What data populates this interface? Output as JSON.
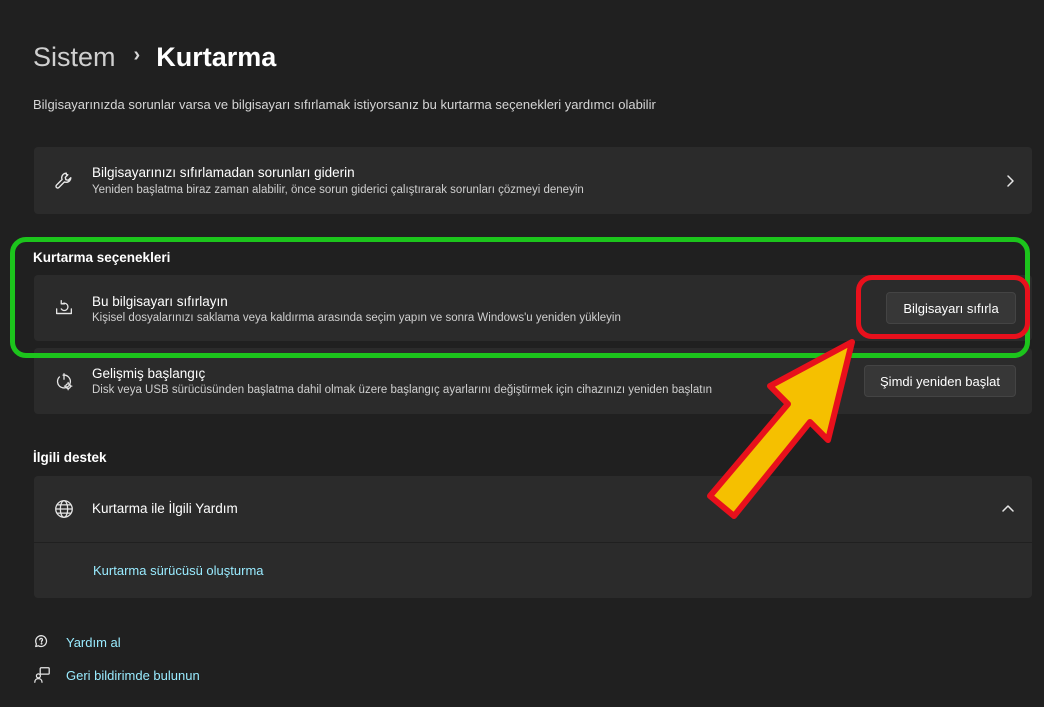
{
  "breadcrumb": {
    "parent": "Sistem",
    "separator": "›",
    "current": "Kurtarma"
  },
  "description": "Bilgisayarınızda sorunlar varsa ve bilgisayarı sıfırlamak istiyorsanız bu kurtarma seçenekleri yardımcı olabilir",
  "troubleshoot_card": {
    "icon": "wrench-icon",
    "title": "Bilgisayarınızı sıfırlamadan sorunları giderin",
    "subtitle": "Yeniden başlatma biraz zaman alabilir, önce sorun giderici çalıştırarak sorunları çözmeyi deneyin"
  },
  "recovery_options": {
    "label": "Kurtarma seçenekleri",
    "reset": {
      "icon": "reset-pc-icon",
      "title": "Bu bilgisayarı sıfırlayın",
      "subtitle": "Kişisel dosyalarınızı saklama veya kaldırma arasında seçim yapın ve sonra Windows'u yeniden yükleyin",
      "button": "Bilgisayarı sıfırla"
    },
    "advanced": {
      "icon": "advanced-startup-icon",
      "title": "Gelişmiş başlangıç",
      "subtitle": "Disk veya USB sürücüsünden başlatma dahil olmak üzere başlangıç ayarlarını değiştirmek için cihazınızı yeniden başlatın",
      "button": "Şimdi yeniden başlat"
    }
  },
  "related_support": {
    "label": "İlgili destek",
    "help_card": {
      "icon": "globe-icon",
      "title": "Kurtarma ile İlgili Yardım",
      "link": "Kurtarma sürücüsü oluşturma"
    }
  },
  "footer": {
    "help": "Yardım al",
    "feedback": "Geri bildirimde bulunun"
  },
  "colors": {
    "background": "#202020",
    "card": "#2b2b2b",
    "link": "#99ebff",
    "annotation_green": "#1cc41c",
    "annotation_red": "#e8101c",
    "arrow_fill": "#f5c000"
  }
}
